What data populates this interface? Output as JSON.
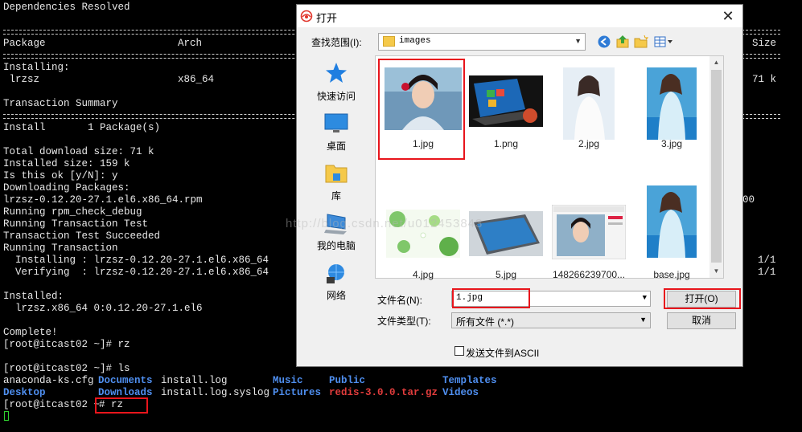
{
  "terminal": {
    "lines": {
      "deps": "Dependencies Resolved",
      "h_package": "Package",
      "h_arch": "Arch",
      "h_size": "Size",
      "installing": "Installing:",
      "lrzsz": " lrzsz",
      "arch_val": "x86_64",
      "size_val": "71 k",
      "txn_summary": "Transaction Summary",
      "install": "Install       1 Package(s)",
      "total_dl": "Total download size: 71 k",
      "installed_size": "Installed size: 159 k",
      "is_ok": "Is this ok [y/N]: y",
      "downloading": "Downloading Packages:",
      "rpm": "lrzsz-0.12.20-27.1.el6.x86_64.rpm",
      "rpm_tail": "00",
      "rpm_check": "Running rpm_check_debug",
      "txn_test": "Running Transaction Test",
      "txn_test_ok": "Transaction Test Succeeded",
      "running_txn": "Running Transaction",
      "installing_pkg": "  Installing : lrzsz-0.12.20-27.1.el6.x86_64",
      "verifying_pkg": "  Verifying  : lrzsz-0.12.20-27.1.el6.x86_64",
      "count1": "1/1",
      "count2": "1/1",
      "installed": "Installed:",
      "installed_pkg": "  lrzsz.x86_64 0:0.12.20-27.1.el6",
      "complete": "Complete!",
      "prompt_rz": "[root@itcast02 ~]# rz",
      "prompt_ls": "[root@itcast02 ~]# ls",
      "prompt_last": "[root@itcast02 ~",
      "last_cmd": "# rz"
    },
    "ls": {
      "anaconda": "anaconda-ks.cfg",
      "documents": "Documents",
      "install_log": "install.log",
      "music": "Music",
      "public": "Public",
      "templates": "Templates",
      "desktop": "Desktop",
      "downloads": "Downloads",
      "install_syslog": "install.log.syslog",
      "pictures": "Pictures",
      "redis": "redis-3.0.0.tar.gz",
      "videos": "Videos"
    },
    "watermark": "http://blog.csdn.net/u012453843"
  },
  "dialog": {
    "title": "打开",
    "look_in_label": "查找范围(I):",
    "look_in_value": "images",
    "places": [
      "快速访问",
      "桌面",
      "库",
      "我的电脑",
      "网络"
    ],
    "files": [
      "1.jpg",
      "1.png",
      "2.jpg",
      "3.jpg",
      "4.jpg",
      "5.jpg",
      "148266239700...",
      "base.jpg"
    ],
    "file_name_label": "文件名(N):",
    "file_name_value": "1.jpg",
    "file_type_label": "文件类型(T):",
    "file_type_value": "所有文件 (*.*)",
    "open_button": "打开(O)",
    "cancel_button": "取消",
    "ascii_label": "发送文件到ASCII"
  },
  "colors": {
    "ls_dir": "#4f8ff0",
    "ls_archive": "#e03c3c",
    "highlight": "#e8151c"
  }
}
